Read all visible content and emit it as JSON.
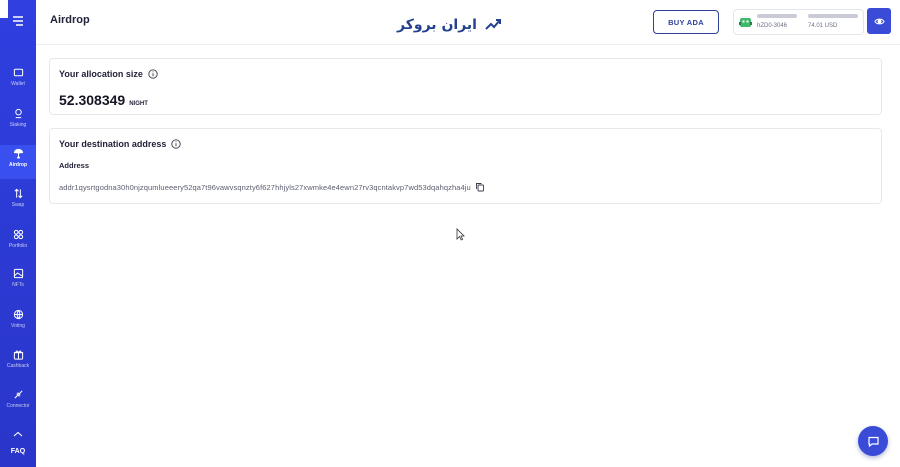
{
  "sidebar": {
    "items": [
      {
        "label": "Wallet",
        "icon": "wallet-icon"
      },
      {
        "label": "Staking",
        "icon": "staking-icon"
      },
      {
        "label": "Airdrop",
        "icon": "airdrop-icon",
        "active": true
      },
      {
        "label": "Swap",
        "icon": "swap-icon"
      },
      {
        "label": "Portfolio",
        "icon": "portfolio-icon"
      },
      {
        "label": "NFTs",
        "icon": "nft-icon"
      },
      {
        "label": "Voting",
        "icon": "voting-icon"
      },
      {
        "label": "Cashback",
        "icon": "cashback-icon"
      },
      {
        "label": "Connector",
        "icon": "connector-icon"
      }
    ],
    "faq_label": "FAQ"
  },
  "header": {
    "title": "Airdrop",
    "brand_text": "ایران بروکر",
    "buy_label": "BUY ADA",
    "wallet": {
      "address": "hZD0-3046",
      "balance_usd": "74.01 USD"
    }
  },
  "allocation": {
    "title": "Your allocation size",
    "value": "52.308349",
    "unit": "NIGHT"
  },
  "destination": {
    "title": "Your destination address",
    "address_label": "Address",
    "address": "addr1qysrtgodna30h0njzqumlueeery52qa7t96vawvsqnzty6f627hhjyls27xwmke4e4ewn27rv3qcntakvp7wd53dqahqzha4ju"
  },
  "colors": {
    "sidebar": "#2f3fe0",
    "accent": "#3a4bd8",
    "brand": "#23418f"
  }
}
